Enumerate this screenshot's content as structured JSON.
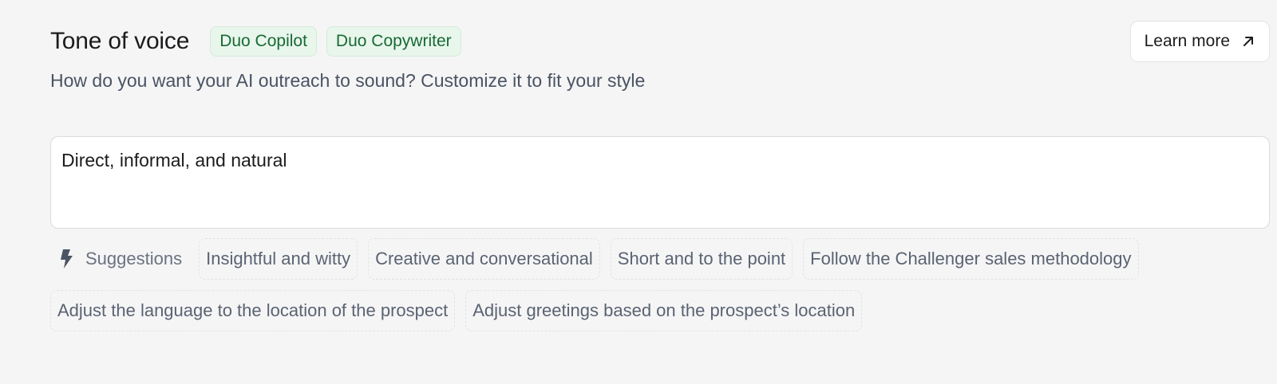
{
  "header": {
    "title": "Tone of voice",
    "badges": [
      "Duo Copilot",
      "Duo Copywriter"
    ],
    "subtitle": "How do you want your AI outreach to sound? Customize it to fit your style"
  },
  "learn_more": {
    "label": "Learn more",
    "icon": "arrow-up-right-icon"
  },
  "tone_input": {
    "value": "Direct, informal, and natural"
  },
  "suggestions": {
    "label": "Suggestions",
    "icon": "lightning-bolt-icon",
    "items": [
      "Insightful and witty",
      "Creative and conversational",
      "Short and to the point",
      "Follow the Challenger sales methodology",
      "Adjust the language to the location of the prospect",
      "Adjust greetings based on the prospect’s location"
    ]
  },
  "colors": {
    "background": "#f5f5f6",
    "badge_bg": "#e9f6ec",
    "badge_text": "#176a34",
    "muted_text": "#6b7280"
  }
}
